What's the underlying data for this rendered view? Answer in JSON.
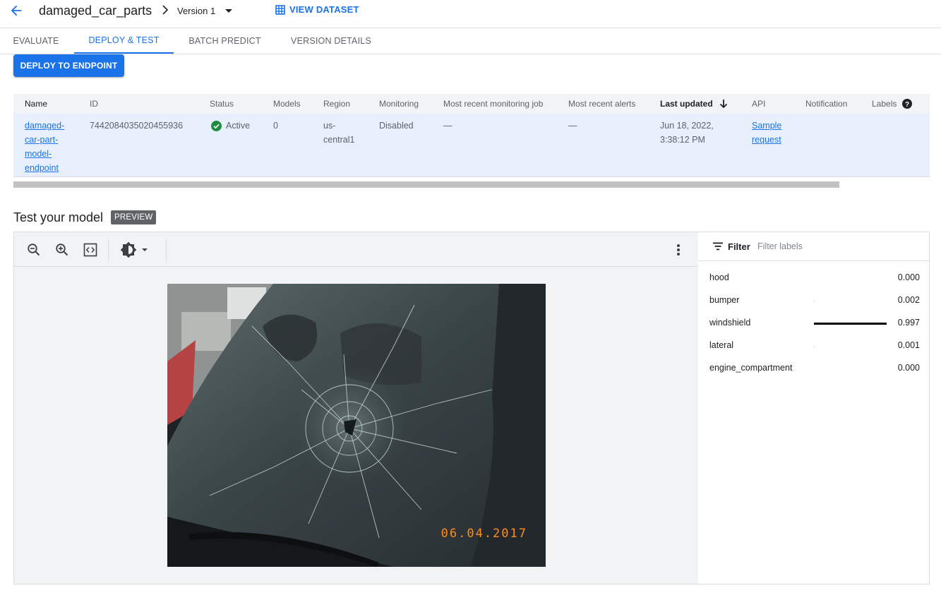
{
  "header": {
    "title": "damaged_car_parts",
    "version": "Version 1",
    "view_dataset": "VIEW DATASET"
  },
  "tabs": [
    {
      "label": "EVALUATE",
      "active": false
    },
    {
      "label": "DEPLOY & TEST",
      "active": true
    },
    {
      "label": "BATCH PREDICT",
      "active": false
    },
    {
      "label": "VERSION DETAILS",
      "active": false
    }
  ],
  "deploy_button": "DEPLOY TO ENDPOINT",
  "table": {
    "columns": [
      "Name",
      "ID",
      "Status",
      "Models",
      "Region",
      "Monitoring",
      "Most recent monitoring job",
      "Most recent alerts",
      "Last updated",
      "API",
      "Notification",
      "Labels"
    ],
    "row": {
      "name_lines": [
        "damaged-",
        "car-part-",
        "model-",
        "endpoint"
      ],
      "id": "7442084035020455936",
      "status": "Active",
      "models": "0",
      "region_lines": [
        "us-",
        "central1"
      ],
      "monitoring": "Disabled",
      "monitoring_job": "—",
      "alerts": "—",
      "updated_lines": [
        "Jun 18, 2022,",
        "3:38:12 PM"
      ],
      "api_lines": [
        "Sample",
        "request"
      ],
      "notification": "",
      "labels": ""
    }
  },
  "test": {
    "title": "Test your model",
    "badge": "PREVIEW",
    "photo_date": "06.04.2017"
  },
  "filter": {
    "label": "Filter",
    "placeholder": "Filter labels"
  },
  "predictions": [
    {
      "label": "hood",
      "score": "0.000",
      "confidence": 0.0
    },
    {
      "label": "bumper",
      "score": "0.002",
      "confidence": 0.002
    },
    {
      "label": "windshield",
      "score": "0.997",
      "confidence": 0.997
    },
    {
      "label": "lateral",
      "score": "0.001",
      "confidence": 0.001
    },
    {
      "label": "engine_compartment",
      "score": "0.000",
      "confidence": 0.0
    }
  ],
  "colors": {
    "accent": "#1a73e8",
    "active_status": "#1e8e3e",
    "selected_row": "#e8f0fe"
  }
}
